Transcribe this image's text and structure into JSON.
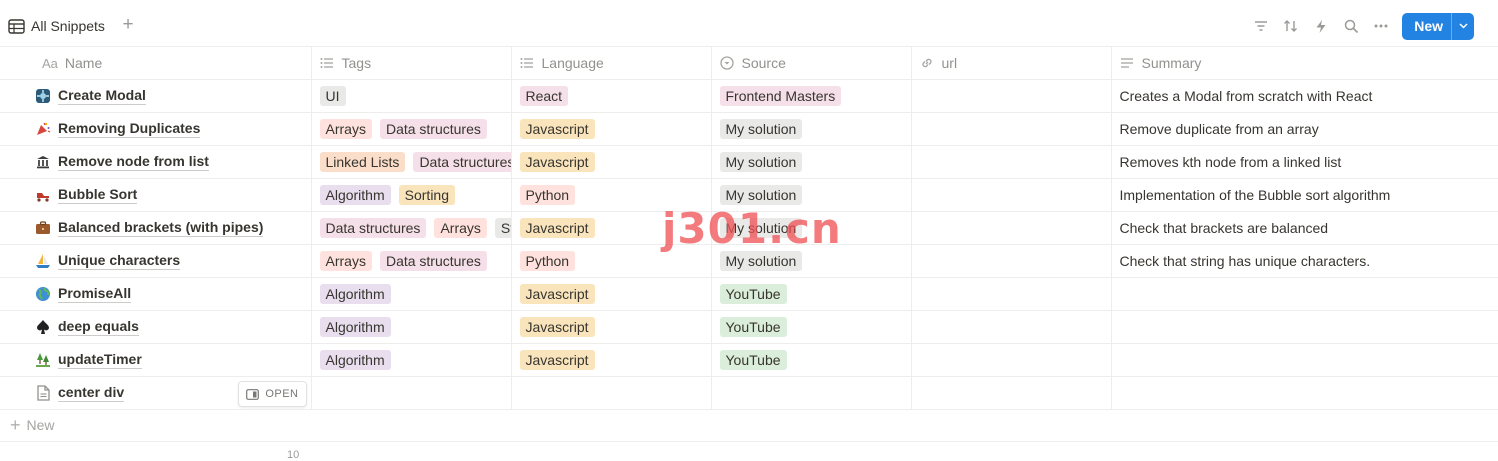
{
  "view": {
    "icon": "table-icon",
    "title": "All Snippets"
  },
  "toolbar": {
    "icons": [
      "filter-icon",
      "sort-icon",
      "automation-icon",
      "search-icon",
      "more-icon"
    ],
    "new_label": "New",
    "accent": "#2383e2"
  },
  "columns": [
    {
      "key": "name",
      "label": "Name",
      "icon": "title-icon"
    },
    {
      "key": "tags",
      "label": "Tags",
      "icon": "multiselect-icon"
    },
    {
      "key": "language",
      "label": "Language",
      "icon": "multiselect-icon"
    },
    {
      "key": "source",
      "label": "Source",
      "icon": "select-icon"
    },
    {
      "key": "url",
      "label": "url",
      "icon": "link-icon"
    },
    {
      "key": "summary",
      "label": "Summary",
      "icon": "text-icon"
    }
  ],
  "name_col_prefix": "Aa",
  "tag_colors": {
    "gray": "#e9e9e7",
    "brown": "#eee0da",
    "orange": "#fadec9",
    "yellow": "#fbf3db",
    "yellow_strong": "#f9e4bc",
    "green": "#dbeddb",
    "blue": "#d3e5ef",
    "purple": "#e8deee",
    "pink": "#f5e0e9",
    "red": "#ffe2dd"
  },
  "rows": [
    {
      "icon": "puzzle-icon",
      "name": "Create Modal",
      "tags": [
        {
          "text": "UI",
          "color": "gray"
        }
      ],
      "language": [
        {
          "text": "React",
          "color": "pink"
        }
      ],
      "source": {
        "text": "Frontend Masters",
        "color": "pink"
      },
      "summary": "Creates a Modal from scratch with React"
    },
    {
      "icon": "party-popper-icon",
      "name": "Removing Duplicates",
      "tags": [
        {
          "text": "Arrays",
          "color": "red"
        },
        {
          "text": "Data structures",
          "color": "pink"
        }
      ],
      "language": [
        {
          "text": "Javascript",
          "color": "yellow_strong"
        }
      ],
      "source": {
        "text": "My solution",
        "color": "gray"
      },
      "summary": "Remove duplicate from an array"
    },
    {
      "icon": "bank-icon",
      "name": "Remove node from list",
      "tags": [
        {
          "text": "Linked Lists",
          "color": "orange"
        },
        {
          "text": "Data structures",
          "color": "pink"
        }
      ],
      "language": [
        {
          "text": "Javascript",
          "color": "yellow_strong"
        }
      ],
      "source": {
        "text": "My solution",
        "color": "gray"
      },
      "summary": "Removes kth node from a linked list"
    },
    {
      "icon": "roller-skate-icon",
      "name": "Bubble Sort",
      "tags": [
        {
          "text": "Algorithm",
          "color": "purple"
        },
        {
          "text": "Sorting",
          "color": "yellow_strong"
        }
      ],
      "language": [
        {
          "text": "Python",
          "color": "red"
        }
      ],
      "source": {
        "text": "My solution",
        "color": "gray"
      },
      "summary": "Implementation of the Bubble sort algorithm"
    },
    {
      "icon": "briefcase-icon",
      "name": "Balanced brackets (with pipes)",
      "tags": [
        {
          "text": "Data structures",
          "color": "pink"
        },
        {
          "text": "Arrays",
          "color": "red"
        },
        {
          "text": "St",
          "color": "gray"
        }
      ],
      "language": [
        {
          "text": "Javascript",
          "color": "yellow_strong"
        }
      ],
      "source": {
        "text": "My solution",
        "color": "gray"
      },
      "summary": "Check that brackets are balanced"
    },
    {
      "icon": "sailboat-icon",
      "name": "Unique characters",
      "tags": [
        {
          "text": "Arrays",
          "color": "red"
        },
        {
          "text": "Data structures",
          "color": "pink"
        }
      ],
      "language": [
        {
          "text": "Python",
          "color": "red"
        }
      ],
      "source": {
        "text": "My solution",
        "color": "gray"
      },
      "summary": "Check that string has unique characters."
    },
    {
      "icon": "globe-icon",
      "name": "PromiseAll",
      "tags": [
        {
          "text": "Algorithm",
          "color": "purple"
        }
      ],
      "language": [
        {
          "text": "Javascript",
          "color": "yellow_strong"
        }
      ],
      "source": {
        "text": "YouTube",
        "color": "green"
      },
      "summary": ""
    },
    {
      "icon": "spade-icon",
      "name": "deep equals",
      "tags": [
        {
          "text": "Algorithm",
          "color": "purple"
        }
      ],
      "language": [
        {
          "text": "Javascript",
          "color": "yellow_strong"
        }
      ],
      "source": {
        "text": "YouTube",
        "color": "green"
      },
      "summary": ""
    },
    {
      "icon": "tree-icon",
      "name": "updateTimer",
      "tags": [
        {
          "text": "Algorithm",
          "color": "purple"
        }
      ],
      "language": [
        {
          "text": "Javascript",
          "color": "yellow_strong"
        }
      ],
      "source": {
        "text": "YouTube",
        "color": "green"
      },
      "summary": ""
    },
    {
      "icon": "page-icon",
      "name": "center div",
      "tags": [],
      "language": [],
      "source": null,
      "summary": "",
      "hover_action": "OPEN"
    }
  ],
  "new_row_label": "New",
  "footer_count": "10",
  "watermark": "j301.cn"
}
